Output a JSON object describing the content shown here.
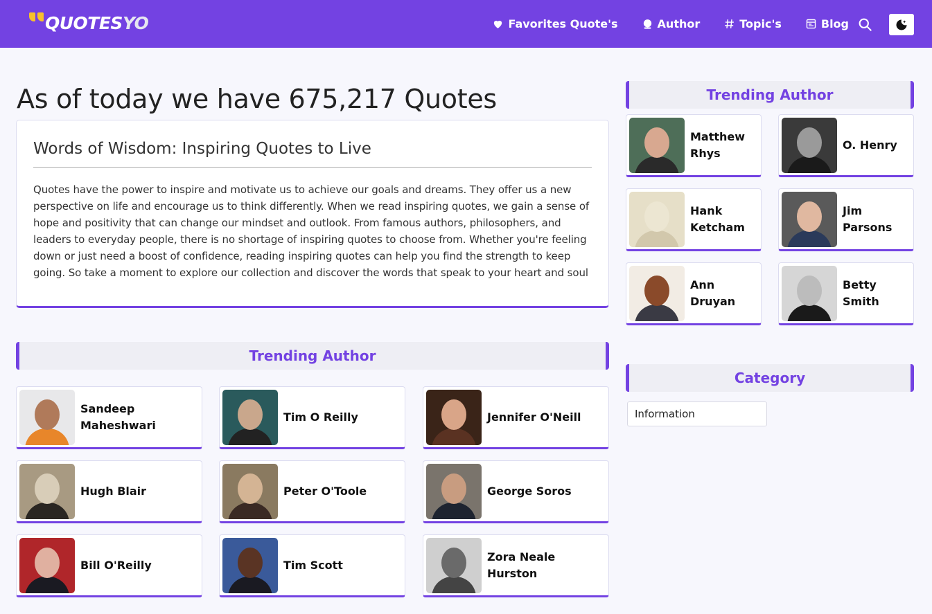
{
  "header": {
    "logo_text_main": "QUOTES",
    "logo_text_accent": "YO",
    "nav": [
      {
        "label": "Favorites Quote's",
        "icon": "heart-icon"
      },
      {
        "label": "Author",
        "icon": "user-icon"
      },
      {
        "label": "Topic's",
        "icon": "hash-icon"
      },
      {
        "label": "Blog",
        "icon": "blog-icon"
      }
    ],
    "search_icon": "search-icon",
    "theme_icon": "moon-icon"
  },
  "main": {
    "title": "As of today we have 675,217 Quotes",
    "wisdom": {
      "title": "Words of Wisdom: Inspiring Quotes to Live",
      "body": "Quotes have the power to inspire and motivate us to achieve our goals and dreams. They offer us a new perspective on life and encourage us to think differently. When we read inspiring quotes, we gain a sense of hope and positivity that can change our mindset and outlook. From famous authors, philosophers, and leaders to everyday people, there is no shortage of inspiring quotes to choose from. Whether you're feeling down or just need a boost of confidence, reading inspiring quotes can help you find the strength to keep going. So take a moment to explore our collection and discover the words that speak to your heart and soul"
    },
    "trending_heading": "Trending Author",
    "authors": [
      {
        "name": "Sandeep Maheshwari"
      },
      {
        "name": "Tim O Reilly"
      },
      {
        "name": "Jennifer O'Neill"
      },
      {
        "name": "Hugh Blair"
      },
      {
        "name": "Peter O'Toole"
      },
      {
        "name": "George Soros"
      },
      {
        "name": "Bill O'Reilly"
      },
      {
        "name": "Tim Scott"
      },
      {
        "name": "Zora Neale Hurston"
      }
    ]
  },
  "sidebar": {
    "trending_heading": "Trending Author",
    "authors": [
      {
        "name": "Matthew Rhys"
      },
      {
        "name": "O. Henry"
      },
      {
        "name": "Hank Ketcham"
      },
      {
        "name": "Jim Parsons"
      },
      {
        "name": "Ann Druyan"
      },
      {
        "name": "Betty Smith"
      }
    ],
    "category_heading": "Category",
    "categories": [
      "Information"
    ]
  },
  "colors": {
    "brand": "#7342e2",
    "logo_accent": "#f7c12b",
    "background": "#f7f7fd"
  }
}
